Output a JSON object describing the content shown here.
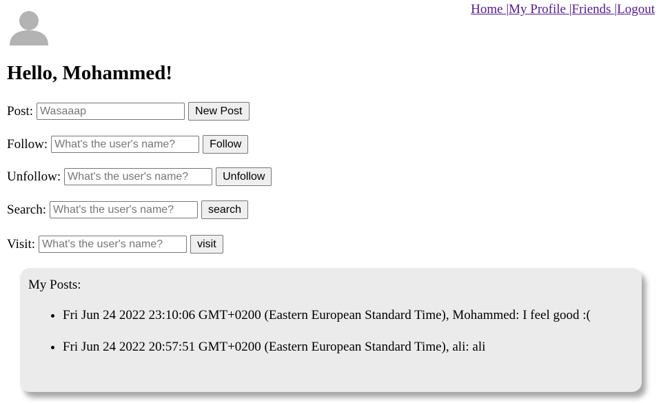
{
  "nav": {
    "items": [
      {
        "label": "Home "
      },
      {
        "label": "My Profile "
      },
      {
        "label": "Friends "
      },
      {
        "label": "Logout"
      }
    ],
    "separator": "|"
  },
  "avatar": {
    "icon": "user-avatar-icon",
    "color": "#b3b3b3"
  },
  "greeting": "Hello, Mohammed!",
  "forms": {
    "post": {
      "label": "Post:",
      "value": "",
      "placeholder": "Wasaaap",
      "button": "New Post"
    },
    "follow": {
      "label": "Follow:",
      "value": "",
      "placeholder": "What's the user's name?",
      "button": "Follow"
    },
    "unfollow": {
      "label": "Unfollow:",
      "value": "",
      "placeholder": "What's the user's name?",
      "button": "Unfollow"
    },
    "search": {
      "label": "Search:",
      "value": "",
      "placeholder": "What's the user's name?",
      "button": "search"
    },
    "visit": {
      "label": "Visit:",
      "value": "",
      "placeholder": "What's the user's name?",
      "button": "visit"
    }
  },
  "posts": {
    "title": "My Posts:",
    "items": [
      {
        "text": "Fri Jun 24 2022 23:10:06 GMT+0200 (Eastern European Standard Time), Mohammed: I feel good :("
      },
      {
        "text": "Fri Jun 24 2022 20:57:51 GMT+0200 (Eastern European Standard Time), ali: ali"
      }
    ]
  },
  "colors": {
    "link": "#551a8b",
    "panel_background": "#ebebeb",
    "button_background": "#efefef"
  }
}
